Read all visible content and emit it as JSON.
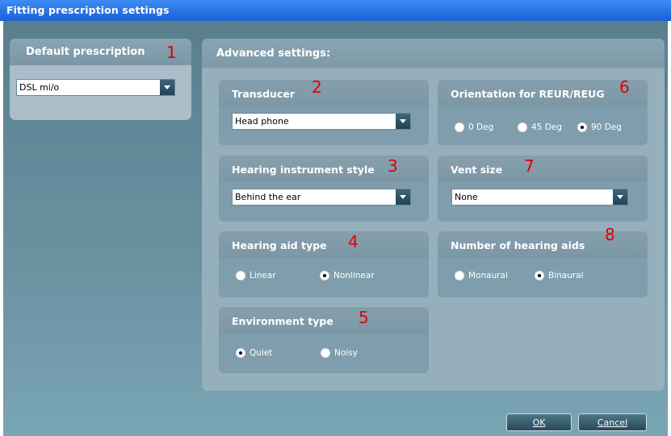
{
  "window": {
    "title": "Fitting prescription settings"
  },
  "default_prescription": {
    "title": "Default prescription",
    "marker": "1",
    "select": {
      "value": "DSL mi/o",
      "arrow_icon": "chevron-down-icon"
    }
  },
  "advanced": {
    "title": "Advanced settings:",
    "transducer": {
      "title": "Transducer",
      "marker": "2",
      "value": "Head phone"
    },
    "instrument_style": {
      "title": "Hearing instrument style",
      "marker": "3",
      "value": "Behind the ear"
    },
    "aid_type": {
      "title": "Hearing aid type",
      "marker": "4",
      "options": [
        "Linear",
        "Nonlinear"
      ],
      "selected": "Nonlinear"
    },
    "environment": {
      "title": "Environment type",
      "marker": "5",
      "options": [
        "Quiet",
        "Noisy"
      ],
      "selected": "Quiet"
    },
    "orientation": {
      "title": "Orientation for REUR/REUG",
      "marker": "6",
      "options": [
        "0 Deg",
        "45 Deg",
        "90 Deg"
      ],
      "selected": "90 Deg"
    },
    "vent": {
      "title": "Vent size",
      "marker": "7",
      "value": "None"
    },
    "num_aids": {
      "title": "Number of hearing aids",
      "marker": "8",
      "options": [
        "Monaural",
        "Binaural"
      ],
      "selected": "Binaural"
    }
  },
  "buttons": {
    "ok": "OK",
    "cancel": "Cancel"
  },
  "colors": {
    "title_bar": "#2a72e8",
    "background": "#6a93a2",
    "marker": "#e00000"
  }
}
